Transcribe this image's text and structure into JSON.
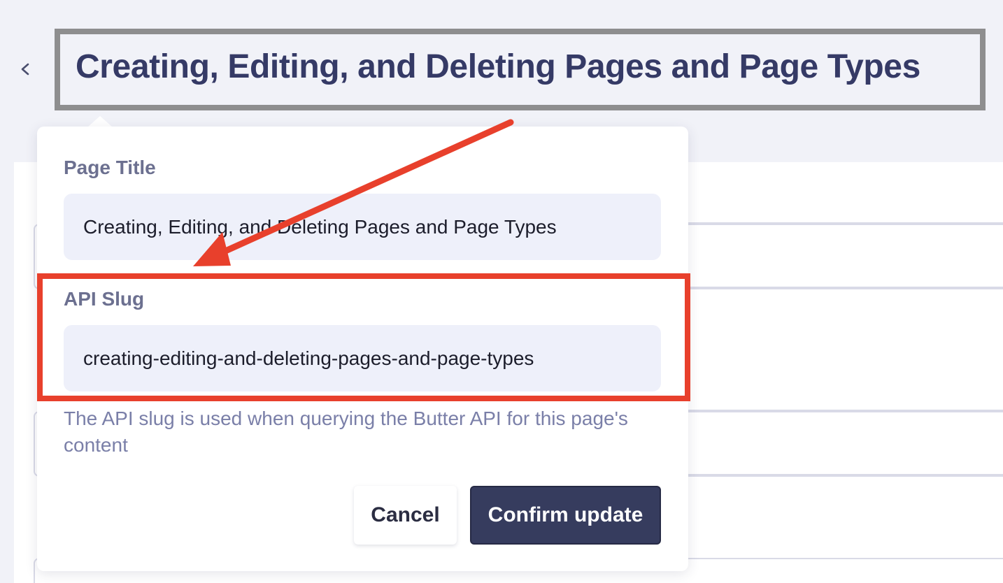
{
  "header": {
    "title": "Creating, Editing, and Deleting Pages and Page Types",
    "back_icon": "chevron-left-icon"
  },
  "popover": {
    "page_title": {
      "label": "Page Title",
      "value": "Creating, Editing, and Deleting Pages and Page Types"
    },
    "api_slug": {
      "label": "API Slug",
      "value": "creating-editing-and-deleting-pages-and-page-types",
      "help": "The API slug is used when querying the Butter API for this page's content"
    },
    "cancel_label": "Cancel",
    "confirm_label": "Confirm update"
  },
  "colors": {
    "accent_primary": "#363c5e",
    "annotation_red": "#e8402c",
    "input_bg": "#eef0fa",
    "title_text": "#353a66"
  }
}
